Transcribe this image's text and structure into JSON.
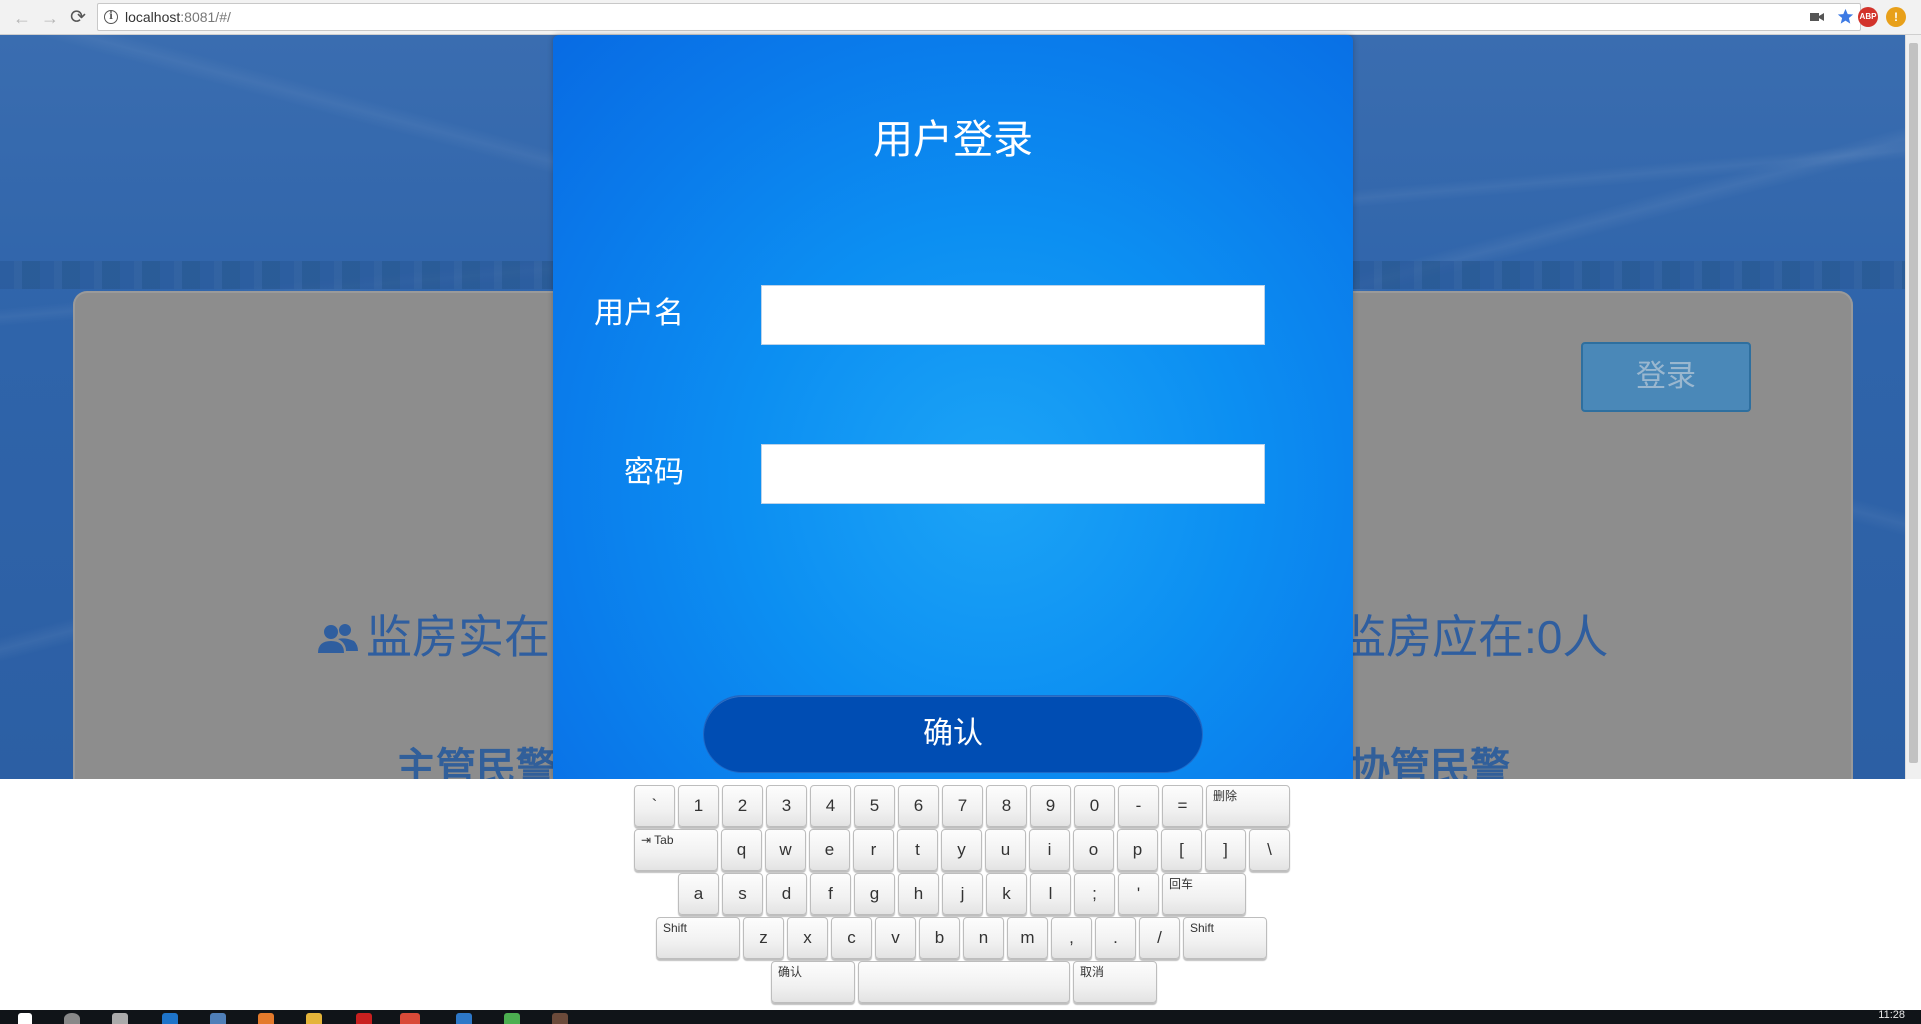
{
  "browser": {
    "url_host": "localhost",
    "url_rest": ":8081/#/",
    "back_glyph": "←",
    "forward_glyph": "→",
    "reload_glyph": "⟳",
    "info_glyph": "i",
    "camera_icon": "camera-icon",
    "star_icon": "star-icon",
    "abp_label": "ABP",
    "alert_label": "!"
  },
  "background_page": {
    "login_button_label": "登录",
    "stat_left": "监房实在",
    "stat_right": "监房应在:0人",
    "police_left": "主管民警",
    "police_right": "协管民警"
  },
  "login_modal": {
    "title": "用户登录",
    "username_label": "用户名",
    "password_label": "密码",
    "username_value": "",
    "password_value": "",
    "confirm_label": "确认"
  },
  "keyboard": {
    "rows": [
      [
        "`",
        "1",
        "2",
        "3",
        "4",
        "5",
        "6",
        "7",
        "8",
        "9",
        "0",
        "-",
        "=",
        "删除"
      ],
      [
        "⇥ Tab",
        "q",
        "w",
        "e",
        "r",
        "t",
        "y",
        "u",
        "i",
        "o",
        "p",
        "[",
        "]",
        "\\"
      ],
      [
        "a",
        "s",
        "d",
        "f",
        "g",
        "h",
        "j",
        "k",
        "l",
        ";",
        "'",
        "回车"
      ],
      [
        "Shift",
        "z",
        "x",
        "c",
        "v",
        "b",
        "n",
        "m",
        ",",
        ".",
        "/",
        "Shift"
      ],
      [
        "确认",
        "",
        "取消"
      ]
    ]
  },
  "taskbar": {
    "clock": "11:28"
  },
  "colors": {
    "modal_blue": "#0c8ff2",
    "confirm_blue": "#004db3",
    "page_blue": "#2f64aa"
  }
}
